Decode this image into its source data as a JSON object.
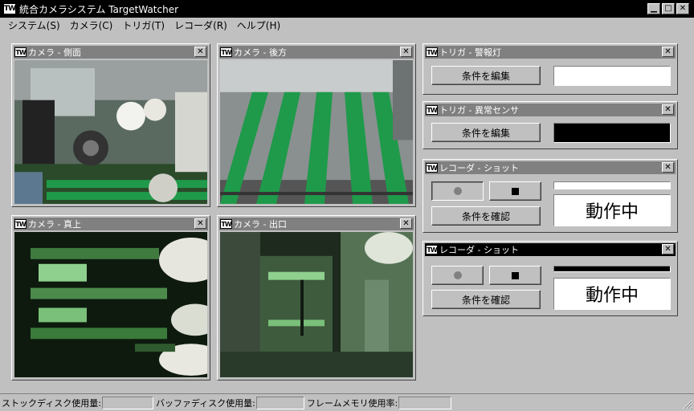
{
  "app": {
    "logo": "TW",
    "title": "統合カメラシステム TargetWatcher",
    "window_buttons": {
      "minimize": "▁",
      "maximize": "□",
      "close": "✕"
    }
  },
  "menu": [
    {
      "label": "システム(S)"
    },
    {
      "label": "カメラ(C)"
    },
    {
      "label": "トリガ(T)"
    },
    {
      "label": "レコーダ(R)"
    },
    {
      "label": "ヘルプ(H)"
    }
  ],
  "cameras": [
    {
      "title": "カメラ - 側面",
      "close": "✕"
    },
    {
      "title": "カメラ - 後方",
      "close": "✕"
    },
    {
      "title": "カメラ - 真上",
      "close": "✕"
    },
    {
      "title": "カメラ - 出口",
      "close": "✕"
    }
  ],
  "triggers": [
    {
      "title": "トリガ - 警報灯",
      "button": "条件を編集",
      "close": "✕",
      "indicator_color": "#ffffff"
    },
    {
      "title": "トリガ - 異常センサ",
      "button": "条件を編集",
      "close": "✕",
      "indicator_color": "#000000"
    }
  ],
  "recorders": [
    {
      "title": "レコーダ - ショット",
      "button": "条件を確認",
      "status": "動作中",
      "close": "✕",
      "indicator_color": "#ffffff",
      "active": false
    },
    {
      "title": "レコーダ - ショット",
      "button": "条件を確認",
      "status": "動作中",
      "close": "✕",
      "indicator_color": "#000000",
      "active": true
    }
  ],
  "statusbar": [
    {
      "label": "ストックディスク使用量:"
    },
    {
      "label": "バッファディスク使用量:"
    },
    {
      "label": "フレームメモリ使用率:"
    }
  ],
  "colors": {
    "titlebar": "#000000",
    "inactive_panel_title": "#808080",
    "face": "#c0c0c0",
    "belt_green": "#1f9a4a"
  }
}
